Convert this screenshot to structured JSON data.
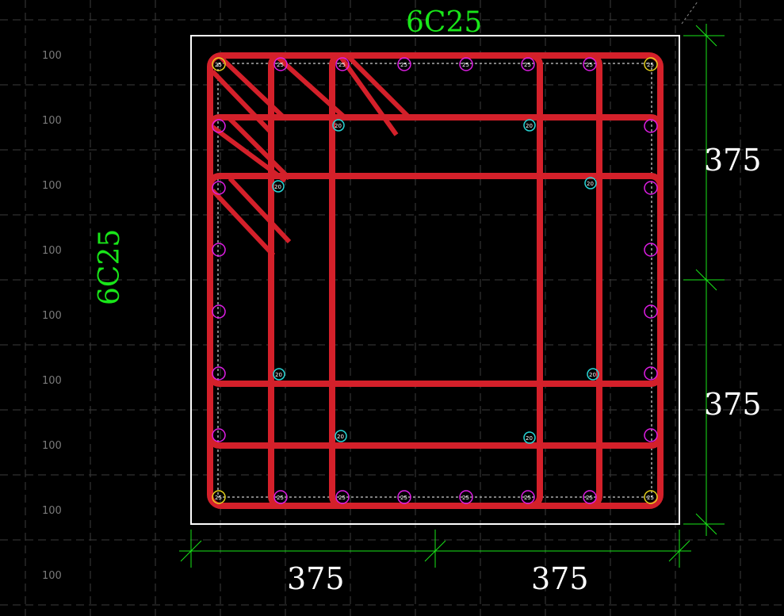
{
  "grid_labels": [
    "100",
    "100",
    "100",
    "100",
    "100",
    "100",
    "100",
    "100",
    "100"
  ],
  "top_rebar_label": "6C25",
  "left_rebar_label": "6C25",
  "dim_right_upper": "375",
  "dim_right_lower": "375",
  "dim_bottom_left": "375",
  "dim_bottom_right": "375",
  "corner_bar_text": "25",
  "side_bar_text": "25",
  "tie_bar_text": "20",
  "colors": {
    "background": "#000000",
    "grid": "#3c3c3c",
    "outline": "#ffffff",
    "stirrup": "#d4202a",
    "corner_bar": "#e6d21e",
    "side_bar": "#e01ee6",
    "tie_bar": "#28d7d7",
    "dimension": "#19e619"
  }
}
